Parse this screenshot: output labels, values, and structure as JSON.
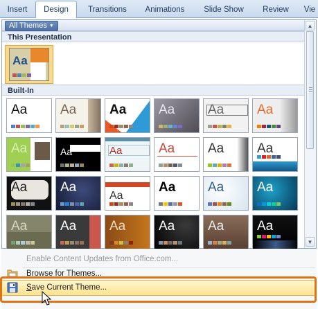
{
  "ribbon": {
    "tabs": [
      {
        "label": "Insert",
        "active": false
      },
      {
        "label": "Design",
        "active": true
      },
      {
        "label": "Transitions",
        "active": false
      },
      {
        "label": "Animations",
        "active": false
      },
      {
        "label": "Slide Show",
        "active": false
      },
      {
        "label": "Review",
        "active": false
      },
      {
        "label": "Vie",
        "active": false
      }
    ]
  },
  "gallery": {
    "filter_label": "All Themes",
    "this_presentation_label": "This Presentation",
    "built_in_label": "Built-In",
    "thumb_label": "Aa"
  },
  "menu": {
    "enable_updates": {
      "label": "Enable Content Updates from Office.com...",
      "enabled": false
    },
    "browse": {
      "label_pre": "Browse for ",
      "label_key": "T",
      "label_post": "hemes..."
    },
    "save": {
      "label_key": "S",
      "label_post": "ave Current Theme..."
    }
  },
  "colors": {
    "highlight_border": "#e07415",
    "menu_hover": "#fde38f",
    "ribbon_tab_text": "#1f3a5f"
  },
  "icons": [
    "chevron-down-icon",
    "scroll-up-icon",
    "scroll-down-icon",
    "browse-themes-icon",
    "save-theme-icon",
    "mouse-pointer-icon"
  ]
}
